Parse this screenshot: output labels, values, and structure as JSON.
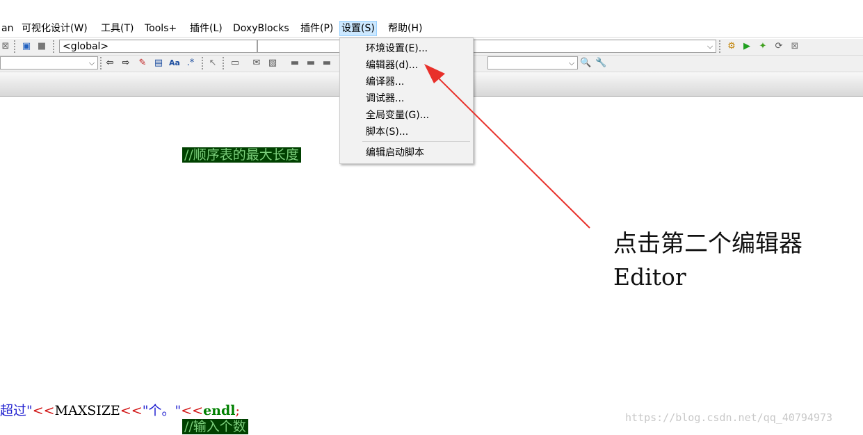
{
  "menubar": {
    "items": [
      {
        "label": "an"
      },
      {
        "label": "可视化设计(W)"
      },
      {
        "label": "工具(T)"
      },
      {
        "label": "Tools+"
      },
      {
        "label": "插件(L)"
      },
      {
        "label": "DoxyBlocks"
      },
      {
        "label": "插件(P)"
      },
      {
        "label": "设置(S)"
      },
      {
        "label": "帮助(H)"
      }
    ],
    "active_item": "设置(S)"
  },
  "toolbar1": {
    "scope_combo_value": "<global>"
  },
  "toolbar2": {
    "find_combo_value": ""
  },
  "settings_menu": {
    "items": [
      {
        "label": "环境设置(E)..."
      },
      {
        "label": "编辑器(d)..."
      },
      {
        "label": "编译器..."
      },
      {
        "label": "调试器..."
      },
      {
        "label": "全局变量(G)..."
      },
      {
        "label": "脚本(S)..."
      },
      {
        "label": "编辑启动脚本"
      }
    ],
    "highlighted": "编辑器(d)..."
  },
  "editor": {
    "comment1": "//顺序表的最大长度",
    "line_code": {
      "part1": "超过\"",
      "part2": "<<",
      "part3": "MAXSIZE",
      "part4": "<<",
      "part5": "\"个。\"",
      "part6": "<<",
      "part7": "endl",
      "part8": ";"
    },
    "comment2": "//输入个数"
  },
  "annotation": {
    "line1": "点击第二个编辑器",
    "line2": "Editor",
    "arrow_color": "#e8302a"
  },
  "watermark": "https://blog.csdn.net/qq_40794973"
}
